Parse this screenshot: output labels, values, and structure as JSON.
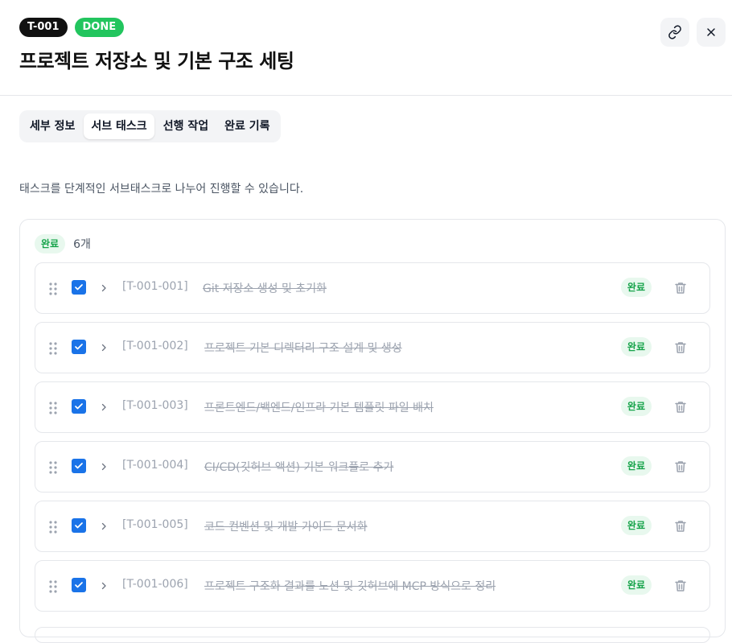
{
  "header": {
    "task_id": "T-001",
    "status": "DONE",
    "title": "프로젝트 저장소 및 기본 구조 세팅",
    "link_icon": "link-icon",
    "close_icon": "close-icon"
  },
  "tabs": [
    {
      "label": "세부 정보",
      "active": false
    },
    {
      "label": "서브 태스크",
      "active": true
    },
    {
      "label": "선행 작업",
      "active": false
    },
    {
      "label": "완료 기록",
      "active": false
    }
  ],
  "description": "태스크를 단계적인 서브태스크로 나누어 진행할 수 있습니다.",
  "group": {
    "status_label": "완료",
    "count_label": "6개",
    "items": [
      {
        "id": "[T-001-001]",
        "title": "Git 저장소 생성 및 초기화",
        "status": "완료",
        "checked": true
      },
      {
        "id": "[T-001-002]",
        "title": "프로젝트 기본 디렉터리 구조 설계 및 생성",
        "status": "완료",
        "checked": true
      },
      {
        "id": "[T-001-003]",
        "title": "프론트엔드/백엔드/인프라 기본 템플릿 파일 배치",
        "status": "완료",
        "checked": true
      },
      {
        "id": "[T-001-004]",
        "title": "CI/CD(깃허브 액션) 기본 워크플로 추가",
        "status": "완료",
        "checked": true
      },
      {
        "id": "[T-001-005]",
        "title": "코드 컨벤션 및 개발 가이드 문서화",
        "status": "완료",
        "checked": true
      },
      {
        "id": "[T-001-006]",
        "title": "프로젝트 구조화 결과를 노션 및 깃허브에 MCP 방식으로 정리",
        "status": "완료",
        "checked": true
      }
    ]
  },
  "colors": {
    "accent": "#1a73e8",
    "done_badge": "#22c55e",
    "done_pill_bg": "#e8f8ee",
    "done_pill_text": "#16a34a"
  }
}
